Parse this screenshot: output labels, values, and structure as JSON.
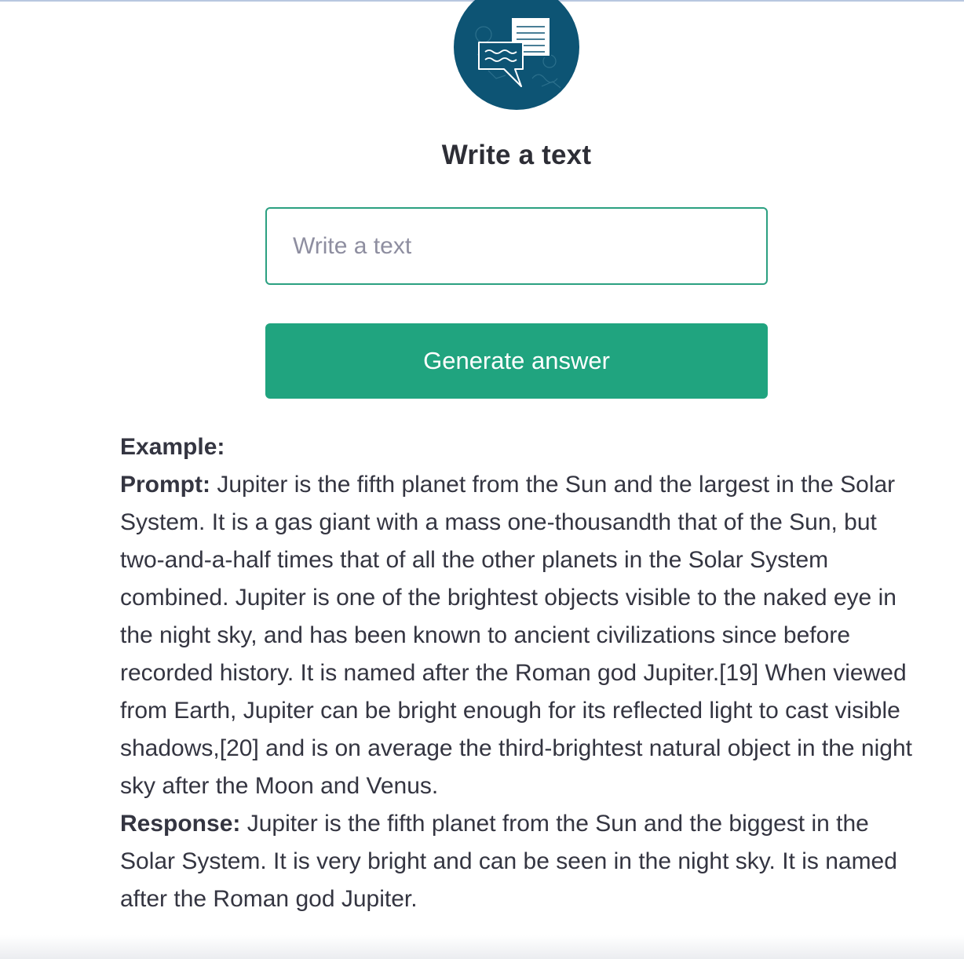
{
  "header": {
    "title": "Write a text",
    "logo_icon": "chat-document-icon",
    "logo_color": "#0d5474"
  },
  "form": {
    "input_placeholder": "Write a text",
    "input_value": "",
    "generate_label": "Generate answer",
    "accent_color": "#20a47f"
  },
  "example": {
    "heading": "Example:",
    "prompt_label": "Prompt:",
    "prompt_text": " Jupiter is the fifth planet from the Sun and the largest in the Solar System. It is a gas giant with a mass one-thousandth that of the Sun, but two-and-a-half times that of all the other planets in the Solar System combined. Jupiter is one of the brightest objects visible to the naked eye in the night sky, and has been known to ancient civilizations since before recorded history. It is named after the Roman god Jupiter.[19] When viewed from Earth, Jupiter can be bright enough for its reflected light to cast visible shadows,[20] and is on average the third-brightest natural object in the night sky after the Moon and Venus.",
    "response_label": "Response:",
    "response_text": " Jupiter is the fifth planet from the Sun and the biggest in the Solar System. It is very bright and can be seen in the night sky. It is named after the Roman god Jupiter."
  }
}
